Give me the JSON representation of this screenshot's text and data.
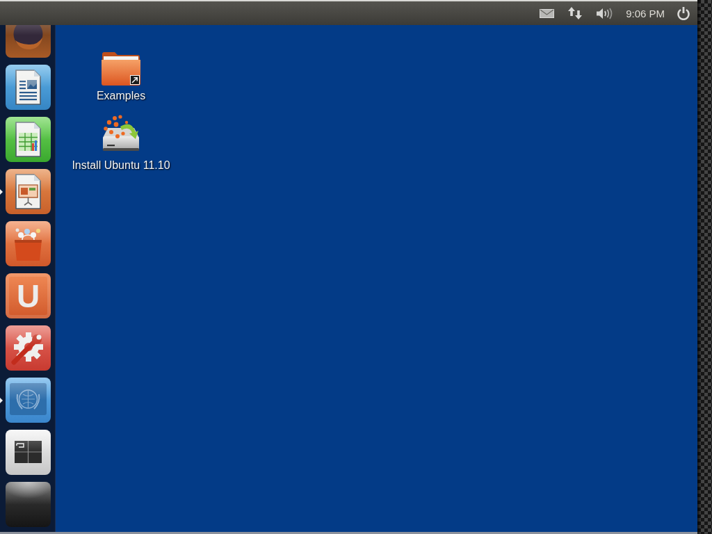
{
  "panel": {
    "clock": "9:06 PM"
  },
  "launcher": {
    "items": [
      {
        "kind": "browser",
        "running": false
      },
      {
        "kind": "writer",
        "running": false
      },
      {
        "kind": "calc",
        "running": false
      },
      {
        "kind": "impress",
        "running": true
      },
      {
        "kind": "store",
        "running": false
      },
      {
        "kind": "letter",
        "glyph": "U",
        "running": false
      },
      {
        "kind": "settings",
        "running": false
      },
      {
        "kind": "emblem",
        "running": true
      },
      {
        "kind": "workspaces",
        "running": false
      },
      {
        "kind": "dark",
        "running": false
      }
    ]
  },
  "desktop": {
    "icons": [
      {
        "kind": "folder",
        "label": "Examples"
      },
      {
        "kind": "installer",
        "label": "Install Ubuntu 11.10"
      }
    ]
  }
}
